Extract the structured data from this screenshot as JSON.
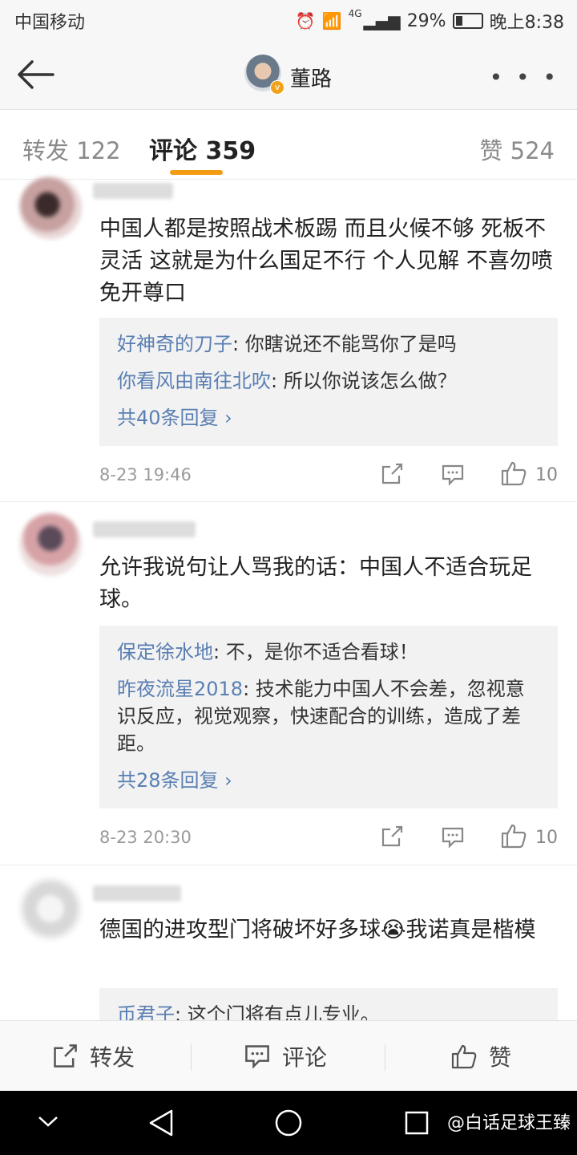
{
  "status_bar": {
    "carrier": "中国移动",
    "network": "4G",
    "battery": "29%",
    "time": "晚上8:38"
  },
  "nav": {
    "title": "董路",
    "more": "• • •"
  },
  "tabs": {
    "repost": "转发 122",
    "comment": "评论 359",
    "like": "赞 524"
  },
  "comments": [
    {
      "text": "中国人都是按照战术板踢 而且火候不够 死板不灵活 这就是为什么国足不行 个人见解 不喜勿喷 免开尊口",
      "replies": [
        {
          "name": "好神奇的刀子",
          "text": ": 你瞎说还不能骂你了是吗"
        },
        {
          "name": "你看风由南往北吹",
          "text": ": 所以你说该怎么做？"
        }
      ],
      "more_replies": "共40条回复 ›",
      "time": "8-23 19:46",
      "likes": "10"
    },
    {
      "text": "允许我说句让人骂我的话：中国人不适合玩足球。",
      "replies": [
        {
          "name": "保定徐水地",
          "text": ": 不，是你不适合看球！"
        },
        {
          "name": "昨夜流星2018",
          "text": ": 技术能力中国人不会差，忽视意识反应，视觉观察，快速配合的训练，造成了差距。"
        }
      ],
      "more_replies": "共28条回复 ›",
      "time": "8-23 20:30",
      "likes": "10"
    },
    {
      "text": "德国的进攻型门将破坏好多球😭我诺真是楷模",
      "replies": [
        {
          "name": "币君子",
          "text": ": 这个门将有点儿专业。"
        }
      ]
    }
  ],
  "action_bar": {
    "repost": "转发",
    "comment": "评论",
    "like": "赞"
  },
  "watermark": "@白话足球王臻"
}
